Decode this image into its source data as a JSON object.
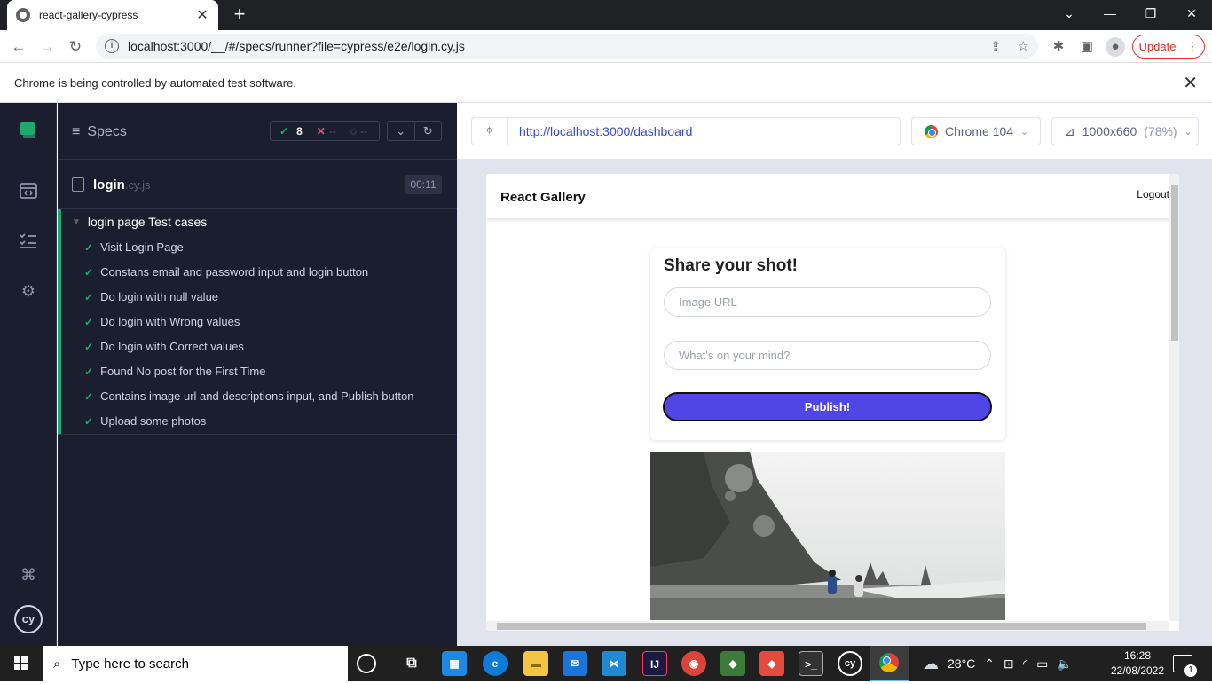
{
  "browser": {
    "tab_title": "react-gallery-cypress",
    "url": "localhost:3000/__/#/specs/runner?file=cypress/e2e/login.cy.js",
    "update_label": "Update",
    "infobar_text": "Chrome is being controlled by automated test software."
  },
  "specs": {
    "title": "Specs",
    "passed": "8",
    "failed": "--",
    "pending": "--",
    "file_name": "login",
    "file_ext": ".cy.js",
    "duration": "00:11",
    "suite_title": "login page Test cases",
    "tests": [
      "Visit Login Page",
      "Constans email and password input and login button",
      "Do login with null value",
      "Do login with Wrong values",
      "Do login with Correct values",
      "Found No post for the First Time",
      "Contains image url and descriptions input, and Publish button",
      "Upload some photos"
    ]
  },
  "aut": {
    "url": "http://localhost:3000/dashboard",
    "browser": "Chrome 104",
    "viewport": "1000x660",
    "scale": "(78%)"
  },
  "app": {
    "brand": "React Gallery",
    "logout": "Logout",
    "card_title": "Share your shot!",
    "image_url_placeholder": "Image URL",
    "mind_placeholder": "What's on your mind?",
    "publish_label": "Publish!"
  },
  "taskbar": {
    "search_placeholder": "Type here to search",
    "weather": "28°C",
    "time": "16:28",
    "date": "22/08/2022",
    "notif_count": "1"
  },
  "colors": {
    "cypress_bg": "#1b1e2e",
    "pass_green": "#1fa971",
    "publish_indigo": "#4f46e5",
    "url_blue": "#3a46cc"
  }
}
